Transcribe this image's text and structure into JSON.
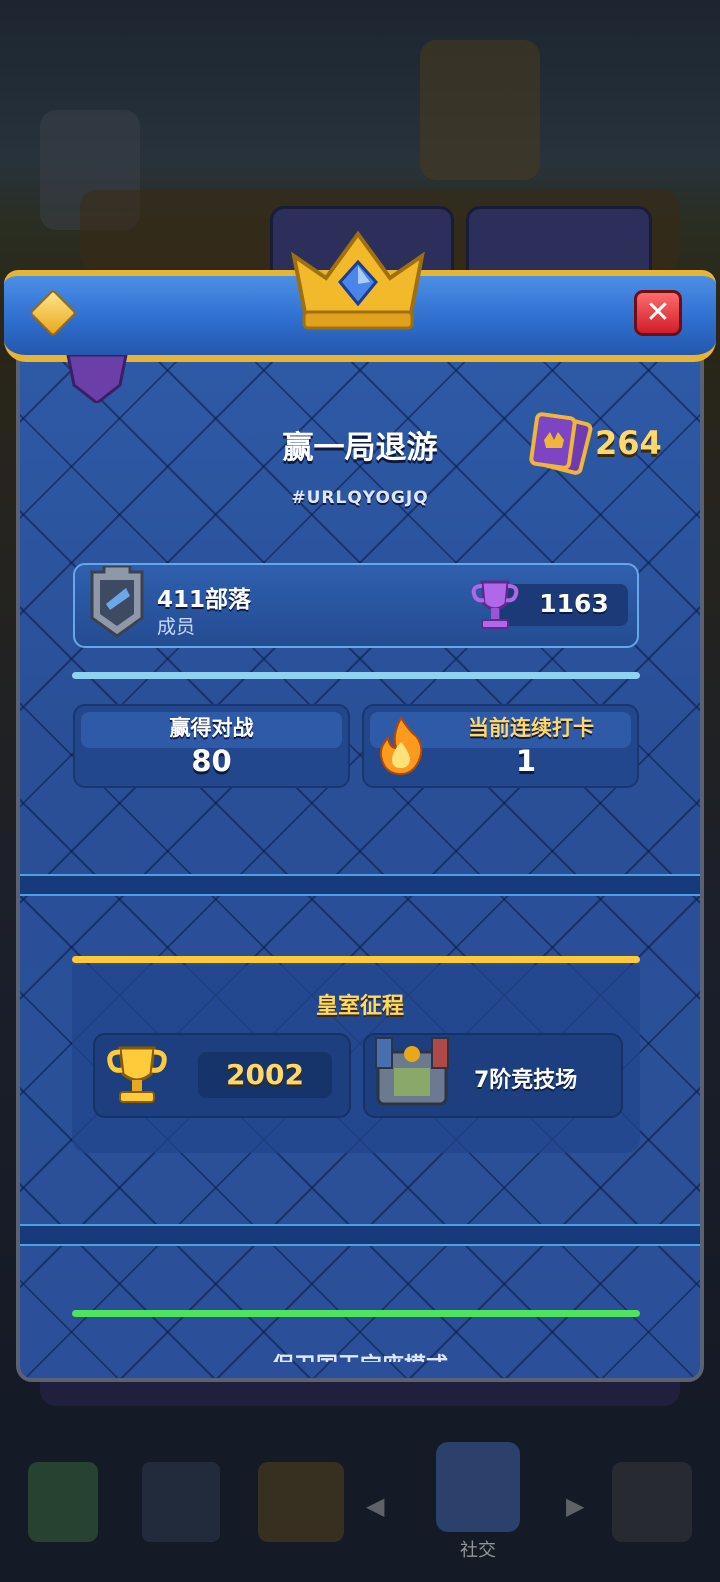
{
  "profile": {
    "player_name": "赢一局退游",
    "player_tag": "#URLQYOGJQ",
    "cards_collected": "264"
  },
  "clan": {
    "name": "411部落",
    "role": "成员",
    "trophies": "1163"
  },
  "stats": {
    "wins_label": "赢得对战",
    "wins_value": "80",
    "streak_label": "当前连续打卡",
    "streak_value": "1"
  },
  "path_of_legends": {
    "title": "皇室征程",
    "trophies": "2002",
    "arena": "7阶竞技场"
  },
  "next_section": {
    "title": "保卫国王宝座模式"
  },
  "bottom_nav": {
    "social_label": "社交"
  },
  "colors": {
    "panel_blue": "#2a4f97",
    "header_gold": "#e7b433",
    "accent_cyan": "#8fd2f2",
    "accent_gold": "#ffc93b",
    "accent_green": "#4fe35e",
    "close_red": "#d11d2a"
  }
}
